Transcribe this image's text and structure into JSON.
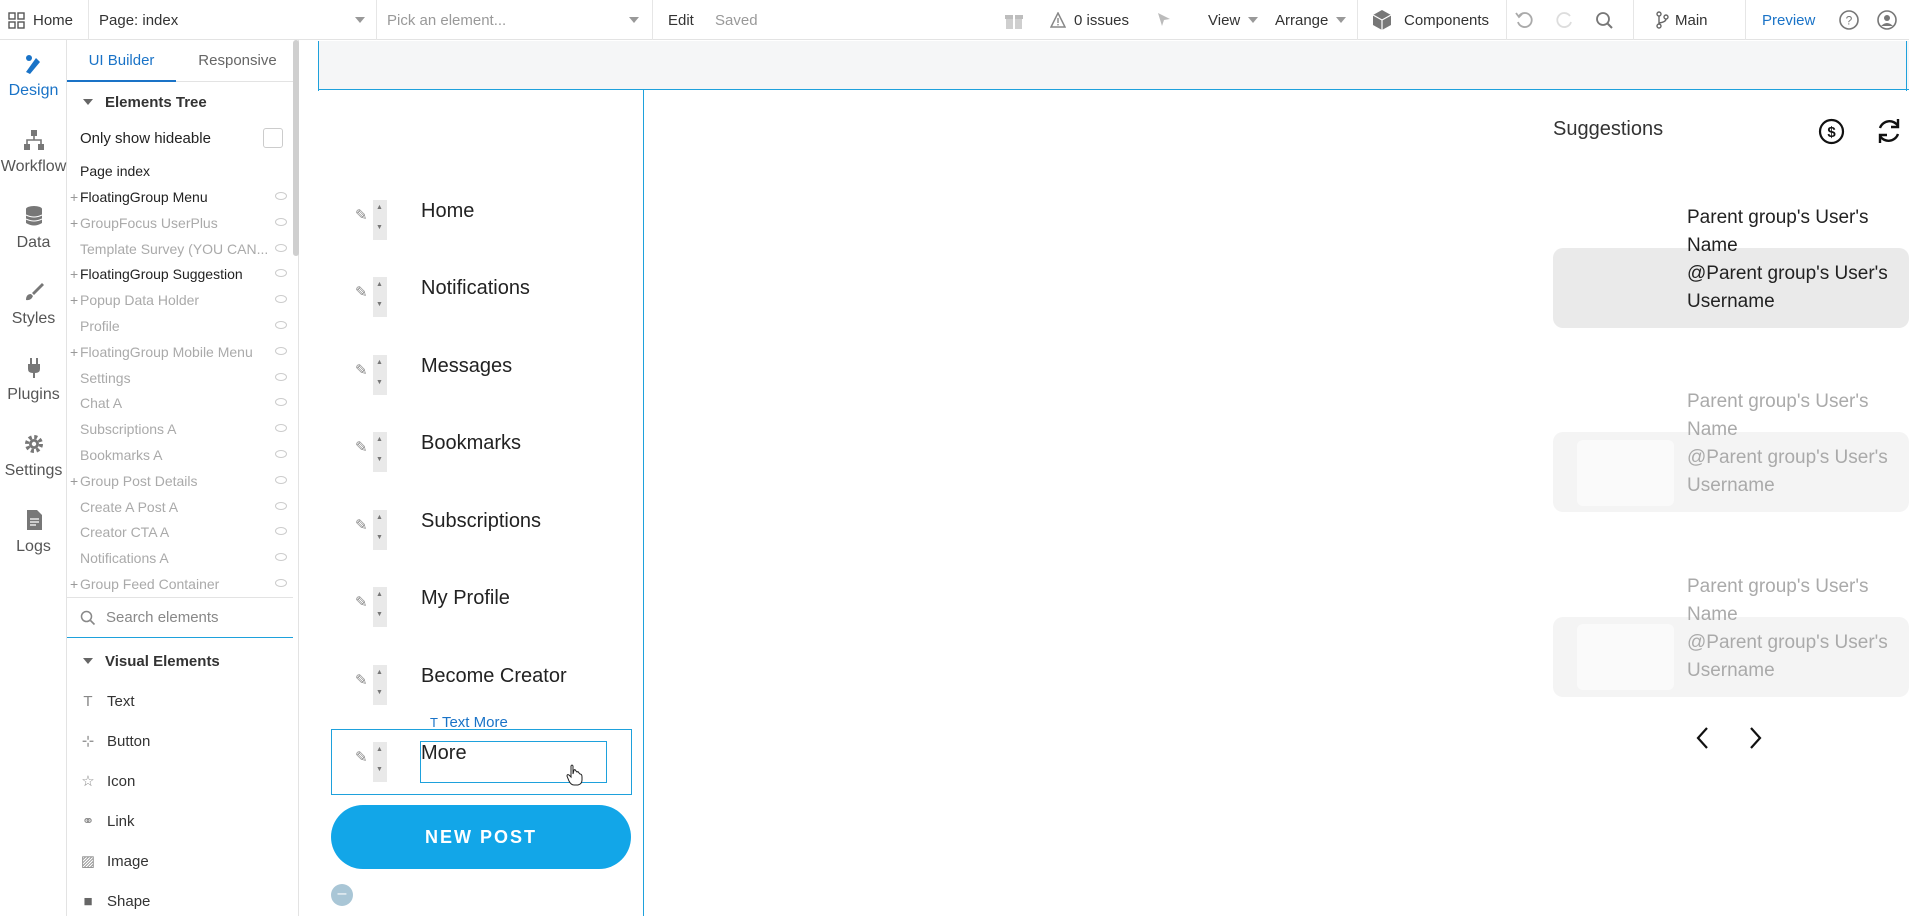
{
  "topbar": {
    "home_label": "Home",
    "page_label": "Page: index",
    "element_picker_placeholder": "Pick an element...",
    "edit_label": "Edit",
    "saved_label": "Saved",
    "issues_label": "0 issues",
    "view_label": "View",
    "arrange_label": "Arrange",
    "components_label": "Components",
    "branch_label": "Main",
    "preview_label": "Preview"
  },
  "leftnav": {
    "items": [
      {
        "label": "Design",
        "icon": "design-icon"
      },
      {
        "label": "Workflow",
        "icon": "workflow-icon"
      },
      {
        "label": "Data",
        "icon": "database-icon"
      },
      {
        "label": "Styles",
        "icon": "brush-icon"
      },
      {
        "label": "Plugins",
        "icon": "plug-icon"
      },
      {
        "label": "Settings",
        "icon": "gear-icon"
      },
      {
        "label": "Logs",
        "icon": "document-icon"
      }
    ]
  },
  "panel": {
    "tabs": [
      "UI Builder",
      "Responsive"
    ],
    "elements_tree_title": "Elements Tree",
    "only_hideable_label": "Only show hideable",
    "page_index_label": "Page index",
    "tree": [
      {
        "label": "FloatingGroup Menu",
        "plus": true,
        "dark": true
      },
      {
        "label": "GroupFocus UserPlus",
        "plus": true,
        "dark": false
      },
      {
        "label": "Template Survey (YOU CAN...",
        "plus": false,
        "dark": false
      },
      {
        "label": "FloatingGroup Suggestion",
        "plus": true,
        "dark": true
      },
      {
        "label": "Popup Data Holder",
        "plus": true,
        "dark": false
      },
      {
        "label": "Profile",
        "plus": false,
        "dark": false
      },
      {
        "label": "FloatingGroup Mobile Menu",
        "plus": true,
        "dark": false
      },
      {
        "label": "Settings",
        "plus": false,
        "dark": false
      },
      {
        "label": "Chat A",
        "plus": false,
        "dark": false
      },
      {
        "label": "Subscriptions A",
        "plus": false,
        "dark": false
      },
      {
        "label": "Bookmarks A",
        "plus": false,
        "dark": false
      },
      {
        "label": "Group Post Details",
        "plus": true,
        "dark": false
      },
      {
        "label": "Create A Post A",
        "plus": false,
        "dark": false
      },
      {
        "label": "Creator CTA A",
        "plus": false,
        "dark": false
      },
      {
        "label": "Notifications A",
        "plus": false,
        "dark": false
      },
      {
        "label": "Group Feed Container",
        "plus": true,
        "dark": false
      }
    ],
    "search_placeholder": "Search elements",
    "visual_elements_title": "Visual Elements",
    "visual_elements": [
      {
        "label": "Text",
        "icon": "text-icon"
      },
      {
        "label": "Button",
        "icon": "button-icon"
      },
      {
        "label": "Icon",
        "icon": "star-icon"
      },
      {
        "label": "Link",
        "icon": "link-icon"
      },
      {
        "label": "Image",
        "icon": "image-icon"
      },
      {
        "label": "Shape",
        "icon": "shape-icon"
      }
    ]
  },
  "canvas": {
    "menu": [
      "Home",
      "Notifications",
      "Messages",
      "Bookmarks",
      "Subscriptions",
      "My Profile",
      "Become Creator",
      "More"
    ],
    "text_more_tag": "Text More",
    "new_post_label": "NEW POST",
    "suggestions_title": "Suggestions",
    "suggestion_line1": "Parent group's User's Name",
    "suggestion_line2": "@Parent group's User's Username"
  },
  "colors": {
    "accent": "#1a73c7",
    "selection": "#1ea1dc",
    "new_post_bg": "#12a6e8"
  }
}
